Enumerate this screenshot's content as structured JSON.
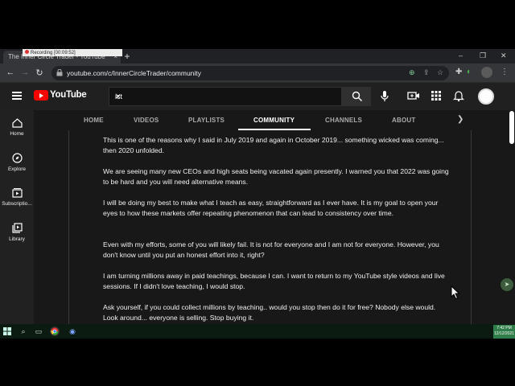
{
  "recording": {
    "label": "Recording [00:09:52]"
  },
  "browser": {
    "tab_title": "The Inner Circle Trader - YouTube",
    "tab_close": "×",
    "new_tab": "+",
    "url": "youtube.com/c/InnerCircleTrader/community",
    "win_minimize": "–",
    "win_maximize": "❐",
    "win_close": "✕"
  },
  "youtube": {
    "logo_text": "YouTube",
    "search_value": "ict",
    "search_clear": "✕"
  },
  "guide": {
    "items": [
      {
        "label": "Home"
      },
      {
        "label": "Explore"
      },
      {
        "label": "Subscriptio..."
      },
      {
        "label": "Library"
      }
    ]
  },
  "channel_tabs": [
    {
      "label": "HOME"
    },
    {
      "label": "VIDEOS"
    },
    {
      "label": "PLAYLISTS"
    },
    {
      "label": "COMMUNITY"
    },
    {
      "label": "CHANNELS"
    },
    {
      "label": "ABOUT"
    }
  ],
  "active_tab": "COMMUNITY",
  "post": {
    "paragraphs": [
      "This is one of the reasons why I said in July 2019 and again in October 2019... something wicked was coming... then 2020 unfolded.",
      "We are seeing many new CEOs and high seats being vacated again presently.  I warned you that 2022 was going to be hard and you will need alternative means.",
      "I will be doing my best to make what I teach as easy, straightforward as I ever have.  It is my goal to open your eyes to how these markets offer repeating phenomenon that can lead to consistency over time.",
      "Even with my efforts, some of you will likely fail.  It is not for everyone and I am not for everyone. However, you don't know until you put an honest effort into it, right?",
      "I am turning millions away in paid teachings, because I can.  I want to return to my YouTube style videos and live sessions.  If I didn't love teaching, I would stop.",
      "Ask yourself, if you could collect millions by teaching..  would you stop then do it for free?  Nobody else would.  Look around... everyone is selling.  Stop buying it."
    ]
  },
  "taskbar": {
    "time": "7:42 PM",
    "date": "12/12/2021"
  },
  "colors": {
    "yt_red": "#ff0000",
    "background": "#181818",
    "accent_green": "#2f7d48"
  }
}
